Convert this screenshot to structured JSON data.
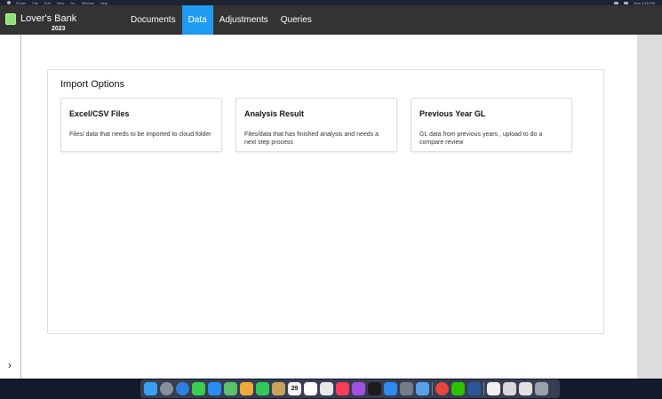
{
  "menubar": {
    "items": [
      "Finder",
      "File",
      "Edit",
      "View",
      "Go",
      "Window",
      "Help"
    ],
    "clock": "Mon 3:18 PM"
  },
  "app": {
    "name": "Lover's Bank",
    "year": "2023",
    "logo_color": "#8ee07a"
  },
  "nav": {
    "tabs": [
      {
        "label": "Documents",
        "active": false
      },
      {
        "label": "Data",
        "active": true
      },
      {
        "label": "Adjustments",
        "active": false
      },
      {
        "label": "Queries",
        "active": false
      }
    ],
    "active_color": "#1e9bf0"
  },
  "panel": {
    "title": "Import Options",
    "cards": [
      {
        "title": "Excel/CSV Files",
        "description": "Files/ data that needs to be imported to cloud folder"
      },
      {
        "title": "Analysis Result",
        "description": "Files/data that has finished analysis and needs a next step process"
      },
      {
        "title": "Previous Year GL",
        "description": "GL data from previous years , upload to do a compare review"
      }
    ]
  },
  "sidebar": {
    "expand_icon": "chevron-right-icon",
    "expand_glyph": "›"
  },
  "dock": {
    "icons": [
      {
        "name": "finder-icon",
        "color": "#3aa0f0"
      },
      {
        "name": "launchpad-icon",
        "color": "#8a8f99"
      },
      {
        "name": "safari-icon",
        "color": "#2f7fe0"
      },
      {
        "name": "messages-icon",
        "color": "#3ccf4e"
      },
      {
        "name": "mail-icon",
        "color": "#2b8df2"
      },
      {
        "name": "maps-icon",
        "color": "#5cc26a"
      },
      {
        "name": "photos-icon",
        "color": "#f2a93b"
      },
      {
        "name": "facetime-icon",
        "color": "#34c759"
      },
      {
        "name": "notes-icon",
        "color": "#c9a35a"
      },
      {
        "name": "calendar-icon",
        "color": "#f4f4f4"
      },
      {
        "name": "reminders-icon",
        "color": "#ffffff"
      },
      {
        "name": "freeform-icon",
        "color": "#e8e8e8"
      },
      {
        "name": "music-icon",
        "color": "#fa3d5a"
      },
      {
        "name": "podcasts-icon",
        "color": "#a050e0"
      },
      {
        "name": "tv-icon",
        "color": "#1c1c1c"
      },
      {
        "name": "app-store-icon",
        "color": "#2d8cf0"
      },
      {
        "name": "system-settings-icon",
        "color": "#777d87"
      },
      {
        "name": "preview-icon",
        "color": "#5aa0e8"
      },
      {
        "name": "chrome-icon",
        "color": "#e8453c"
      },
      {
        "name": "wechat-icon",
        "color": "#2dc100"
      },
      {
        "name": "word-icon",
        "color": "#2b579a"
      },
      {
        "name": "document-thumbnail-icon",
        "color": "#f0f0f0"
      },
      {
        "name": "window-thumbnail-icon",
        "color": "#d8d8d8"
      },
      {
        "name": "window-thumbnail-icon-2",
        "color": "#e2e2e2"
      },
      {
        "name": "trash-icon",
        "color": "#9aa3ad"
      }
    ]
  },
  "calendar_day": "29"
}
